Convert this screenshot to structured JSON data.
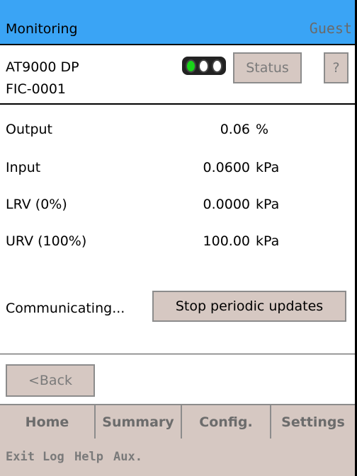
{
  "header": {
    "title": "Monitoring",
    "user": "Guest"
  },
  "device": {
    "model": "AT9000 DP",
    "tag": "FIC-0001",
    "led_states": [
      "on",
      "off",
      "off"
    ]
  },
  "buttons": {
    "status": "Status",
    "help": "?",
    "stop": "Stop periodic updates",
    "back": "<Back"
  },
  "readings": [
    {
      "label": "Output",
      "value": "0.06",
      "unit": "%"
    },
    {
      "label": "Input",
      "value": "0.0600",
      "unit": "kPa"
    },
    {
      "label": "LRV (0%)",
      "value": "0.0000",
      "unit": "kPa"
    },
    {
      "label": "URV (100%)",
      "value": "100.00",
      "unit": "kPa"
    }
  ],
  "status_text": "Communicating...",
  "tabs": [
    "Home",
    "Summary",
    "Config.",
    "Settings"
  ],
  "menu": [
    "Exit",
    "Log",
    "Help",
    "Aux."
  ],
  "colors": {
    "titlebar": "#3aa4f5",
    "button": "#d6c8c2",
    "led_on": "#19d419"
  }
}
